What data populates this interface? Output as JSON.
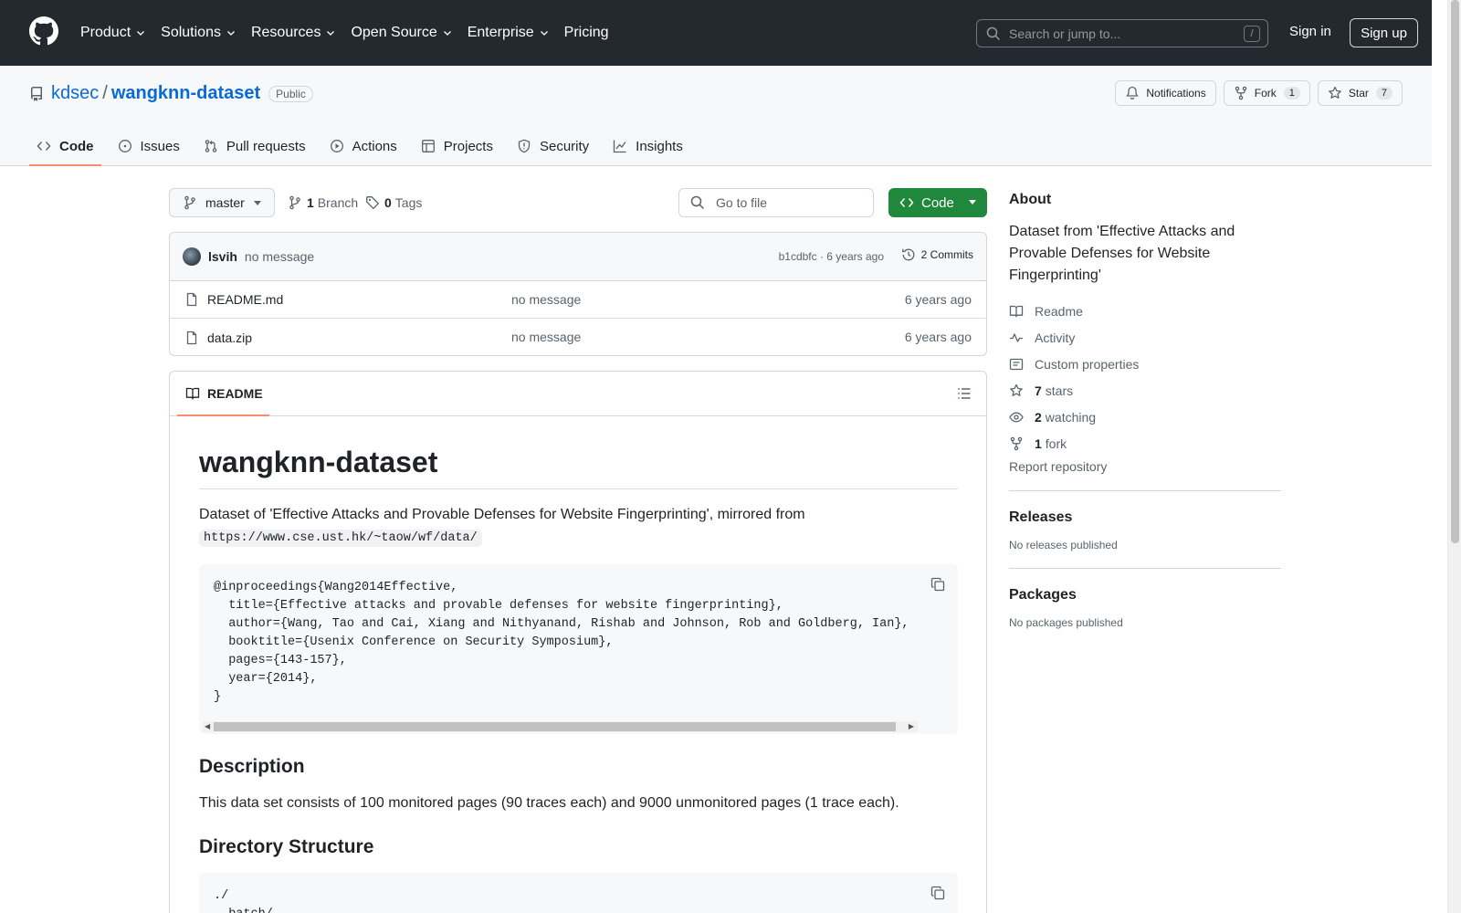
{
  "header": {
    "nav": [
      "Product",
      "Solutions",
      "Resources",
      "Open Source",
      "Enterprise",
      "Pricing"
    ],
    "search_placeholder": "Search or jump to...",
    "search_shortcut": "/",
    "sign_in": "Sign in",
    "sign_up": "Sign up"
  },
  "repo": {
    "owner": "kdsec",
    "separator": "/",
    "name": "wangknn-dataset",
    "visibility": "Public",
    "notifications_label": "Notifications",
    "fork_label": "Fork",
    "fork_count": "1",
    "star_label": "Star",
    "star_count": "7",
    "tabs": [
      "Code",
      "Issues",
      "Pull requests",
      "Actions",
      "Projects",
      "Security",
      "Insights"
    ]
  },
  "toolbar": {
    "branch": "master",
    "branch_count": "1",
    "branch_label": "Branch",
    "tag_count": "0",
    "tag_label": "Tags",
    "goto_placeholder": "Go to file",
    "code_button": "Code"
  },
  "commit": {
    "author": "lsvih",
    "message": "no message",
    "meta": "b1cdbfc · 6 years ago",
    "count_label": "2 Commits"
  },
  "files": [
    {
      "name": "README.md",
      "message": "no message",
      "time": "6 years ago"
    },
    {
      "name": "data.zip",
      "message": "no message",
      "time": "6 years ago"
    }
  ],
  "readme": {
    "tab_label": "README",
    "title": "wangknn-dataset",
    "intro": "Dataset of 'Effective Attacks and Provable Defenses for Website Fingerprinting', mirrored from",
    "url": "https://www.cse.ust.hk/~taow/wf/data/",
    "bibtex": "@inproceedings{Wang2014Effective,\n  title={Effective attacks and provable defenses for website fingerprinting},\n  author={Wang, Tao and Cai, Xiang and Nithyanand, Rishab and Johnson, Rob and Goldberg, Ian},\n  booktitle={Usenix Conference on Security Symposium},\n  pages={143-157},\n  year={2014},\n}",
    "description_heading": "Description",
    "description": "This data set consists of 100 monitored pages (90 traces each) and 9000 unmonitored pages (1 trace each).",
    "directory_heading": "Directory Structure",
    "directory": "./\n  batch/"
  },
  "sidebar": {
    "about_heading": "About",
    "about_text": "Dataset from 'Effective Attacks and Provable Defenses for Website Fingerprinting'",
    "readme": "Readme",
    "activity": "Activity",
    "custom_properties": "Custom properties",
    "stars_count": "7",
    "stars_label": "stars",
    "watching_count": "2",
    "watching_label": "watching",
    "fork_count": "1",
    "fork_label": "fork",
    "report": "Report repository",
    "releases_heading": "Releases",
    "releases_text": "No releases published",
    "packages_heading": "Packages",
    "packages_text": "No packages published"
  },
  "colors": {
    "header_bg": "#24292f",
    "link": "#0969da",
    "accent_green": "#1f883d",
    "tab_underline": "#fd8c73"
  }
}
